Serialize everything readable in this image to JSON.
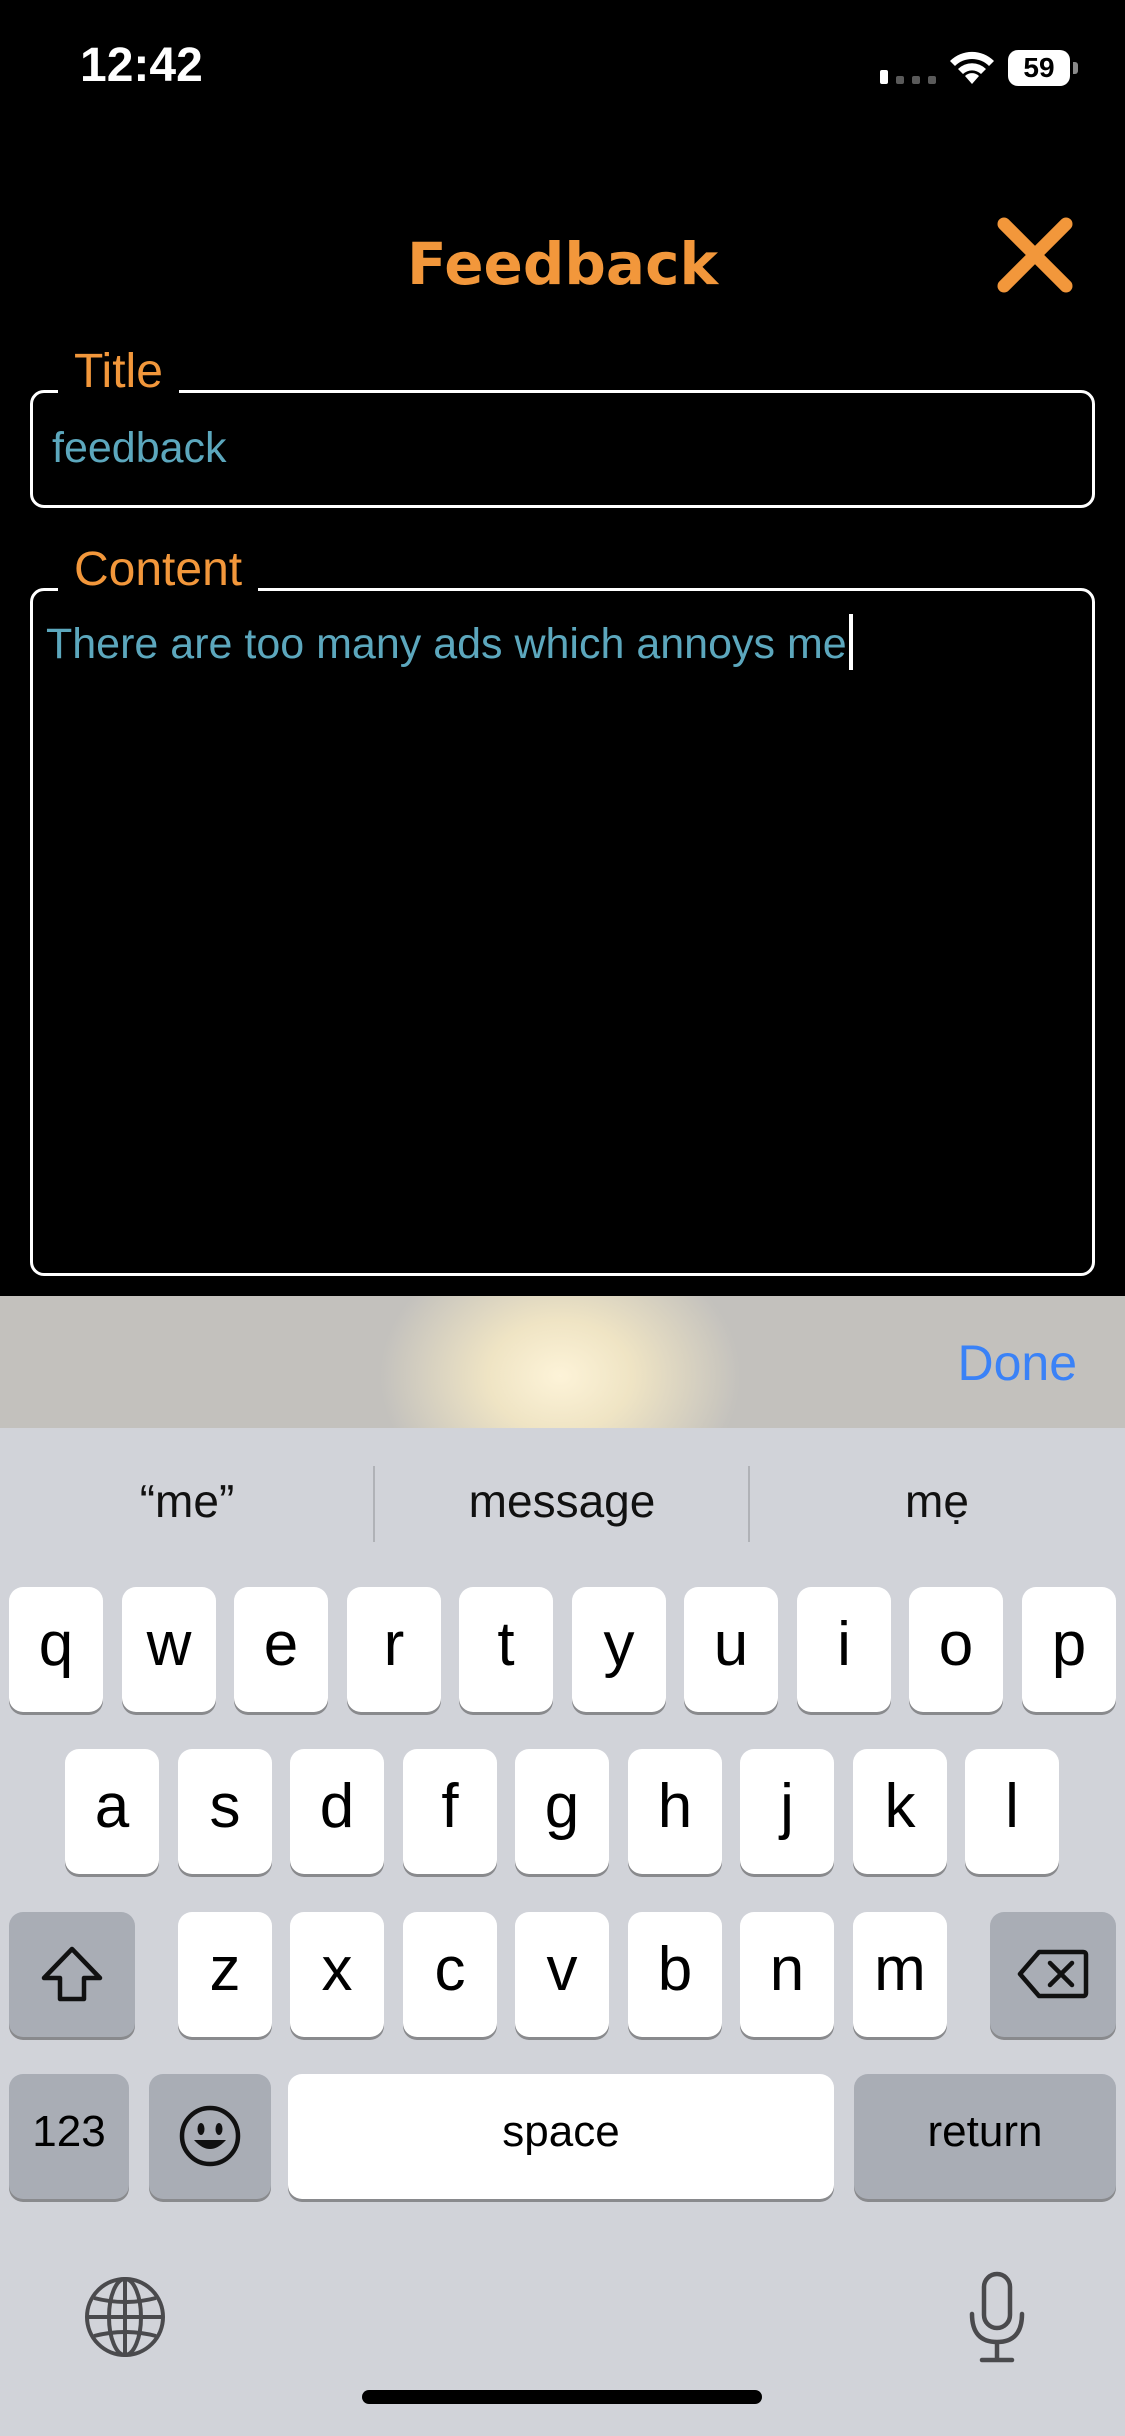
{
  "status_bar": {
    "time": "12:42",
    "battery": "59"
  },
  "header": {
    "title": "Feedback",
    "close_icon": "close-x-icon"
  },
  "form": {
    "title_label": "Title",
    "title_value": "feedback",
    "content_label": "Content",
    "content_value": "There are too many ads which annoys me"
  },
  "accessory": {
    "done_label": "Done"
  },
  "keyboard": {
    "suggestions": [
      "“me”",
      "message",
      "mẹ"
    ],
    "row1": [
      "q",
      "w",
      "e",
      "r",
      "t",
      "y",
      "u",
      "i",
      "o",
      "p"
    ],
    "row2": [
      "a",
      "s",
      "d",
      "f",
      "g",
      "h",
      "j",
      "k",
      "l"
    ],
    "row3": [
      "z",
      "x",
      "c",
      "v",
      "b",
      "n",
      "m"
    ],
    "numbers_label": "123",
    "space_label": "space",
    "return_label": "return"
  },
  "colors": {
    "accent": "#F2973B",
    "input_text": "#5CA7BD",
    "done": "#3A82F7"
  }
}
